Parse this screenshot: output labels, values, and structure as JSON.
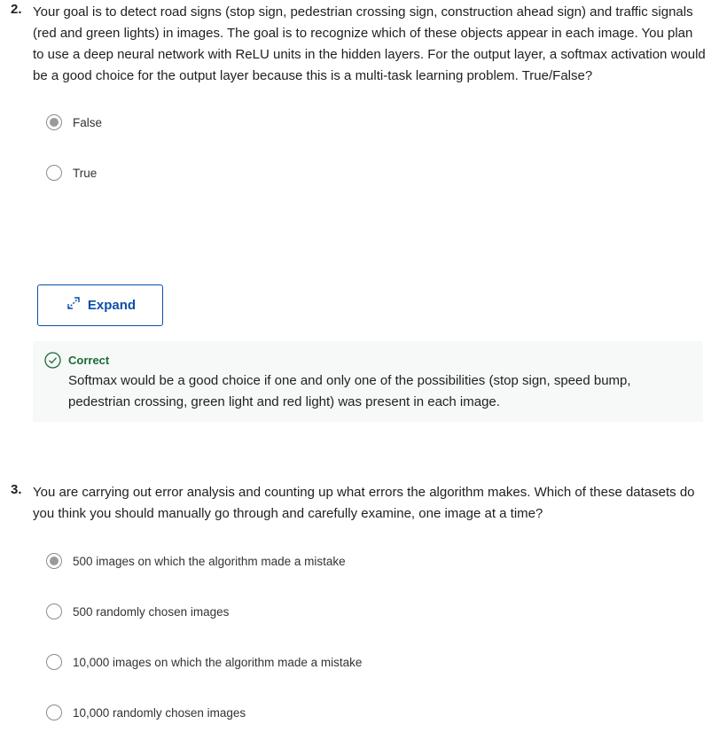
{
  "question2": {
    "number": "2.",
    "text": "Your goal is to detect road signs (stop sign, pedestrian crossing sign, construction ahead sign) and traffic signals (red and green lights) in images. The goal is to recognize which of these objects appear in each image. You plan to use a deep neural network with ReLU units in the hidden layers.  For the output layer, a softmax activation would be a good choice for the output layer because this is a multi-task learning problem. True/False?",
    "options": [
      {
        "label": "False",
        "selected": true
      },
      {
        "label": "True",
        "selected": false
      }
    ],
    "expand_label": "Expand",
    "feedback": {
      "title": "Correct",
      "text": "Softmax would be a good choice if one and only one of the possibilities (stop sign, speed bump, pedestrian crossing, green light and red light) was present in each image."
    }
  },
  "question3": {
    "number": "3.",
    "text": "You are carrying out error analysis and counting up what errors the algorithm makes. Which of these datasets do you think you should manually go through and carefully examine, one image at a time?",
    "options": [
      {
        "label": "500 images on which the algorithm made a mistake",
        "selected": true
      },
      {
        "label": "500 randomly chosen images",
        "selected": false
      },
      {
        "label": "10,000 images on which the algorithm made a mistake",
        "selected": false
      },
      {
        "label": "10,000 randomly chosen images",
        "selected": false
      }
    ]
  },
  "colors": {
    "accent": "#0b4fa8",
    "correct": "#1d6b3a",
    "feedback_bg": "#f6f9f7"
  }
}
